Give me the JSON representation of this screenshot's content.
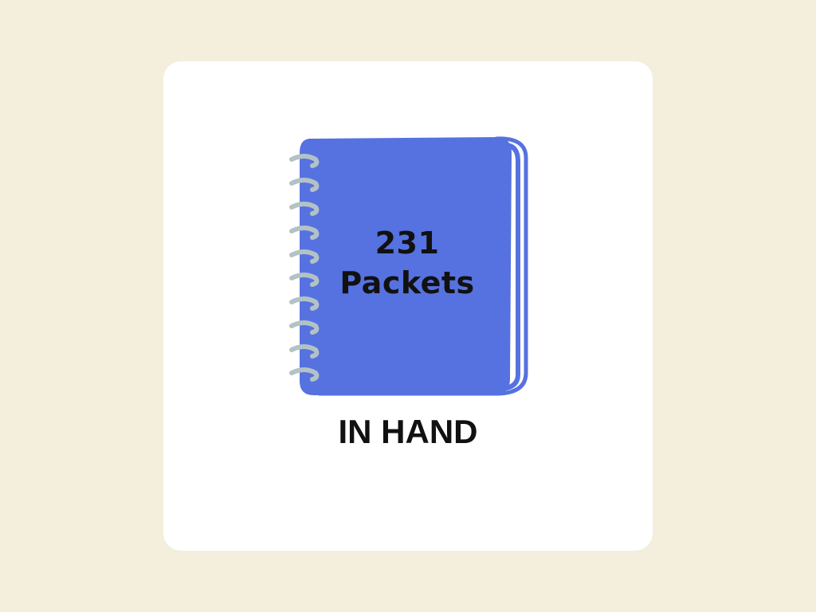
{
  "card": {
    "count": "231",
    "unit": "Packets",
    "caption": "IN HAND"
  },
  "icon": "spiral-notebook-icon",
  "colors": {
    "background": "#f3efdc",
    "card": "#ffffff",
    "notebook_cover": "#5672e0",
    "spiral": "#b3c2c4",
    "text": "#111111"
  }
}
